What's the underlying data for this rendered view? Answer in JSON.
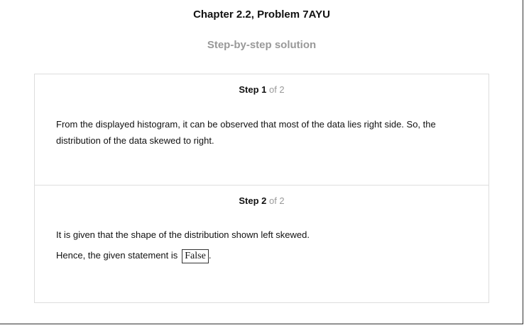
{
  "header": {
    "chapter_title": "Chapter 2.2, Problem 7AYU",
    "subtitle": "Step-by-step solution"
  },
  "steps": [
    {
      "word": "Step 1",
      "of": " of 2",
      "text": "From the displayed histogram, it can be observed that most of the data lies right side. So, the distribution of the data skewed to right."
    },
    {
      "word": "Step 2",
      "of": " of 2",
      "line1": "It is given that the shape of the distribution shown left skewed.",
      "line2_prefix": "Hence, the given statement is",
      "answer": "False",
      "line2_suffix": "."
    }
  ]
}
